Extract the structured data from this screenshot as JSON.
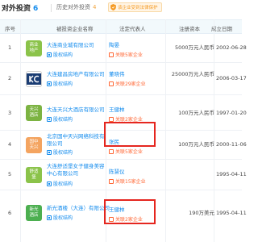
{
  "tabs": {
    "main_label": "对外投资",
    "main_count": "6",
    "history_label": "历史对外投资",
    "history_count": "4",
    "badge_text": "该企业受到法律保护"
  },
  "columns": [
    "序号",
    "被投资企业名称",
    "法定代表人",
    "注册资本",
    "成立日期"
  ],
  "rows": [
    {
      "num": "1",
      "logo_text": "商业\n地产",
      "logo_color": "#8bc34a",
      "name": "大连商业城有限公司",
      "report": "股权结构",
      "person": "陶晏",
      "related": "关联5家企业",
      "capital": "5000万元人民币",
      "date": "2002-06-28"
    },
    {
      "num": "2",
      "logo_text": "KC",
      "logo_color": "#1a3c73",
      "name": "大连建昌房地产有限公司",
      "report": "股权结构",
      "person": "董晓伟",
      "related": "关联29家企业",
      "capital": "25000万元人民币",
      "date": "2006-03-17"
    },
    {
      "num": "3",
      "logo_text": "天兴\n酒店",
      "logo_color": "#7cb342",
      "name": "大连天兴大酒店有限公司",
      "report": "股权结构",
      "person": "王健林",
      "related": "关联2家企业",
      "capital": "100万元人民币",
      "date": "1997-01-20"
    },
    {
      "num": "4",
      "logo_text": "国中\n天兴",
      "logo_color": "#f4a460",
      "name": "北京国中天兴网络科技有限公司",
      "report": "股权结构",
      "person": "张民",
      "related": "关联5家企业",
      "capital": "100万元人民币",
      "date": "2000-11-06"
    },
    {
      "num": "5",
      "logo_text": "舒适\n堡",
      "logo_color": "#8bc34a",
      "name": "大连舒适堡女子健身美容中心有限公司",
      "report": "股权结构",
      "person": "陈慧仪",
      "related": "关联15家企业",
      "capital": "",
      "date": "1995-04-11"
    },
    {
      "num": "6",
      "logo_text": "新光\n酒店",
      "logo_color": "#4caf50",
      "name": "新光酒楼（大连）有限公司",
      "report": "股权结构",
      "person": "王健林",
      "related": "关联2家企业",
      "capital": "190万美元",
      "date": "1995-04-11"
    }
  ]
}
